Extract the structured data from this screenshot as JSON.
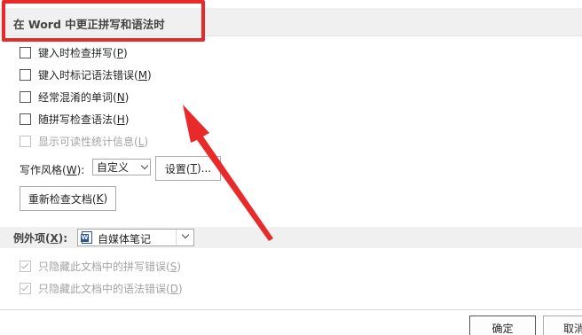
{
  "section": {
    "title": "在 Word 中更正拼写和语法时"
  },
  "options": [
    {
      "label": "键入时检查拼写(",
      "accel": "P",
      "suffix": ")",
      "checked": false,
      "disabled": false
    },
    {
      "label": "键入时标记语法错误(",
      "accel": "M",
      "suffix": ")",
      "checked": false,
      "disabled": false
    },
    {
      "label": "经常混淆的单词(",
      "accel": "N",
      "suffix": ")",
      "checked": false,
      "disabled": false
    },
    {
      "label": "随拼写检查语法(",
      "accel": "H",
      "suffix": ")",
      "checked": false,
      "disabled": false
    },
    {
      "label": "显示可读性统计信息(",
      "accel": "L",
      "suffix": ")",
      "checked": false,
      "disabled": true
    }
  ],
  "writing_style": {
    "label": "写作风格(",
    "accel": "W",
    "suffix": "):",
    "value": "自定义",
    "settings_label": "设置(",
    "settings_accel": "T",
    "settings_suffix": ")..."
  },
  "recheck": {
    "label": "重新检查文档(",
    "accel": "K",
    "suffix": ")"
  },
  "exceptions": {
    "label": "例外项(",
    "accel": "X",
    "suffix": "):",
    "document": "自媒体笔记",
    "document_icon": "word-doc-icon",
    "items": [
      {
        "label": "只隐藏此文档中的拼写错误(",
        "accel": "S",
        "suffix": ")",
        "checked": true,
        "disabled": true
      },
      {
        "label": "只隐藏此文档中的语法错误(",
        "accel": "D",
        "suffix": ")",
        "checked": true,
        "disabled": true
      }
    ]
  },
  "footer": {
    "ok_label": "确定",
    "cancel_label": "取消"
  },
  "annotation": {
    "highlight_color": "#e82a2a",
    "arrow_color": "#e82a2a"
  }
}
